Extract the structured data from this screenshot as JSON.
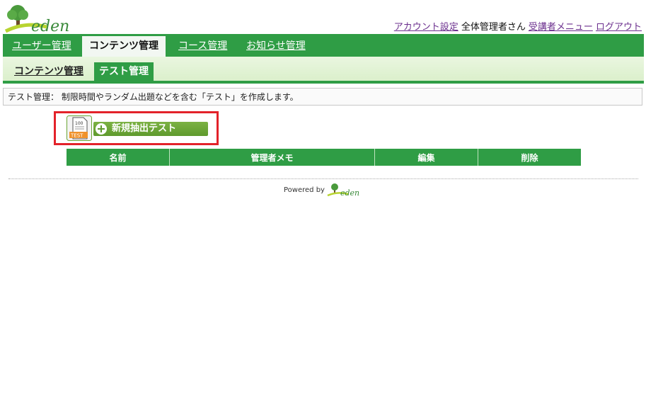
{
  "header": {
    "logo_text": "eden",
    "links": {
      "account_settings": "アカウント設定",
      "user_name": "全体管理者さん",
      "learner_menu": "受講者メニュー",
      "logout": "ログアウト"
    }
  },
  "main_nav": {
    "tabs": [
      {
        "label": "ユーザー管理",
        "active": false
      },
      {
        "label": "コンテンツ管理",
        "active": true
      },
      {
        "label": "コース管理",
        "active": false
      },
      {
        "label": "お知らせ管理",
        "active": false
      }
    ]
  },
  "sub_nav": {
    "tabs": [
      {
        "label": "コンテンツ管理",
        "active": false
      },
      {
        "label": "テスト管理",
        "active": true
      }
    ]
  },
  "description": "テスト管理： 制限時間やランダム出題などを含む「テスト」を作成します。",
  "new_button": {
    "label": "新規抽出テスト",
    "icon_text_top": "100",
    "icon_text_bottom": "TEST"
  },
  "table": {
    "headers": [
      "名前",
      "管理者メモ",
      "編集",
      "削除"
    ]
  },
  "footer": {
    "powered_by": "Powered by",
    "logo_text": "eden"
  },
  "colors": {
    "nav_green": "#2f9d45",
    "button_green": "#6aa535",
    "highlight_red": "#e3222a",
    "link_purple": "#6b2f8e"
  }
}
